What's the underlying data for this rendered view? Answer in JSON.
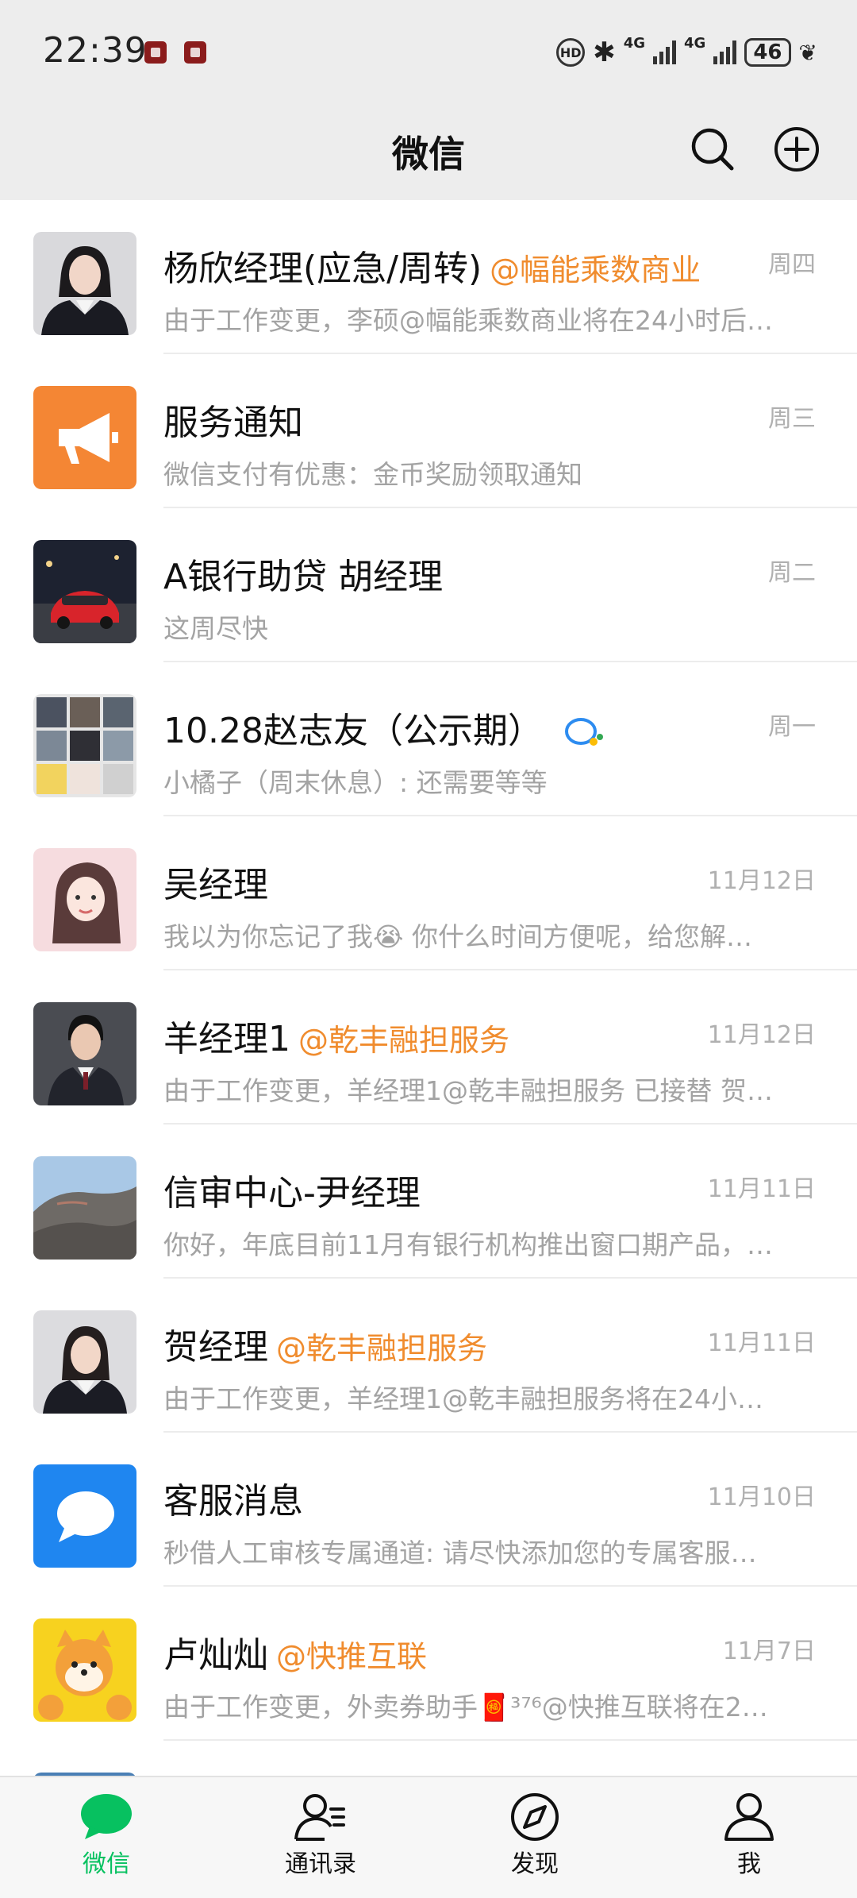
{
  "status_bar": {
    "time": "22:39",
    "network_1": "4G",
    "network_2": "4G",
    "hd_badge": "HD",
    "battery": "46"
  },
  "header": {
    "title": "微信",
    "search_icon": "search-icon",
    "add_icon": "add-circle-icon"
  },
  "chats": [
    {
      "name": "杨欣经理(应急/周转)",
      "tag": "@幅能乘数商业",
      "time": "周四",
      "preview": "由于工作变更，李硕@幅能乘数商业将在24小时后…",
      "avatar": "photo-woman-suit"
    },
    {
      "name": "服务通知",
      "tag": "",
      "time": "周三",
      "preview": "微信支付有优惠：金币奖励领取通知",
      "avatar": "megaphone-icon"
    },
    {
      "name": "A银行助贷 胡经理",
      "tag": "",
      "time": "周二",
      "preview": "这周尽快",
      "avatar": "photo-red-car"
    },
    {
      "name": "10.28赵志友（公示期）",
      "tag": "",
      "time": "周一",
      "preview": "小橘子（周末休息）: 还需要等等",
      "avatar": "group-collage"
    },
    {
      "name": "吴经理",
      "tag": "",
      "time": "11月12日",
      "preview": "我以为你忘记了我😭 你什么时间方便呢，给您解…",
      "avatar": "illustration-girl"
    },
    {
      "name": "羊经理1",
      "tag": "@乾丰融担服务",
      "time": "11月12日",
      "preview": "由于工作变更，羊经理1@乾丰融担服务 已接替 贺…",
      "avatar": "photo-man-suit"
    },
    {
      "name": "信审中心-尹经理",
      "tag": "",
      "time": "11月11日",
      "preview": "你好，年底目前11月有银行机构推出窗口期产品，…",
      "avatar": "photo-rock"
    },
    {
      "name": "贺经理",
      "tag": "@乾丰融担服务",
      "time": "11月11日",
      "preview": "由于工作变更，羊经理1@乾丰融担服务将在24小…",
      "avatar": "photo-woman-suit"
    },
    {
      "name": "客服消息",
      "tag": "",
      "time": "11月10日",
      "preview": "秒借人工审核专属通道: 请尽快添加您的专属客服…",
      "avatar": "chat-bubble-icon"
    },
    {
      "name": "卢灿灿",
      "tag": "@快推互联",
      "time": "11月7日",
      "preview": "由于工作变更，外卖券助手🧧³⁷⁶@快推互联将在2…",
      "avatar": "cartoon-shiba"
    }
  ],
  "bottom_nav": [
    {
      "label": "微信",
      "icon": "chat-icon",
      "active": true
    },
    {
      "label": "通讯录",
      "icon": "contacts-icon",
      "active": false
    },
    {
      "label": "发现",
      "icon": "compass-icon",
      "active": false
    },
    {
      "label": "我",
      "icon": "person-icon",
      "active": false
    }
  ],
  "colors": {
    "accent_green": "#07c160",
    "tag_orange": "#f08c2e",
    "header_bg": "#ededed"
  }
}
